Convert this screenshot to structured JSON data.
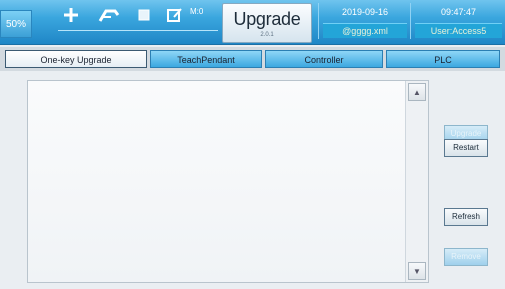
{
  "header": {
    "zoom": "50%",
    "mode": "M:0",
    "title": "Upgrade",
    "subtitle": "2.0.1",
    "date": "2019-09-16",
    "time": "09:47:47",
    "file": "@gggg.xml",
    "user": "User:Access5",
    "tools": [
      "plus-icon",
      "robot-arm-icon",
      "blank-square-icon",
      "edit-icon"
    ]
  },
  "tabs": [
    "One-key Upgrade",
    "TeachPendant",
    "Controller",
    "PLC"
  ],
  "active_tab": "One-key Upgrade",
  "list": {
    "items": []
  },
  "buttons": {
    "upgrade": "Upgrade",
    "restart": "Restart",
    "refresh": "Refresh",
    "remove": "Remove"
  }
}
